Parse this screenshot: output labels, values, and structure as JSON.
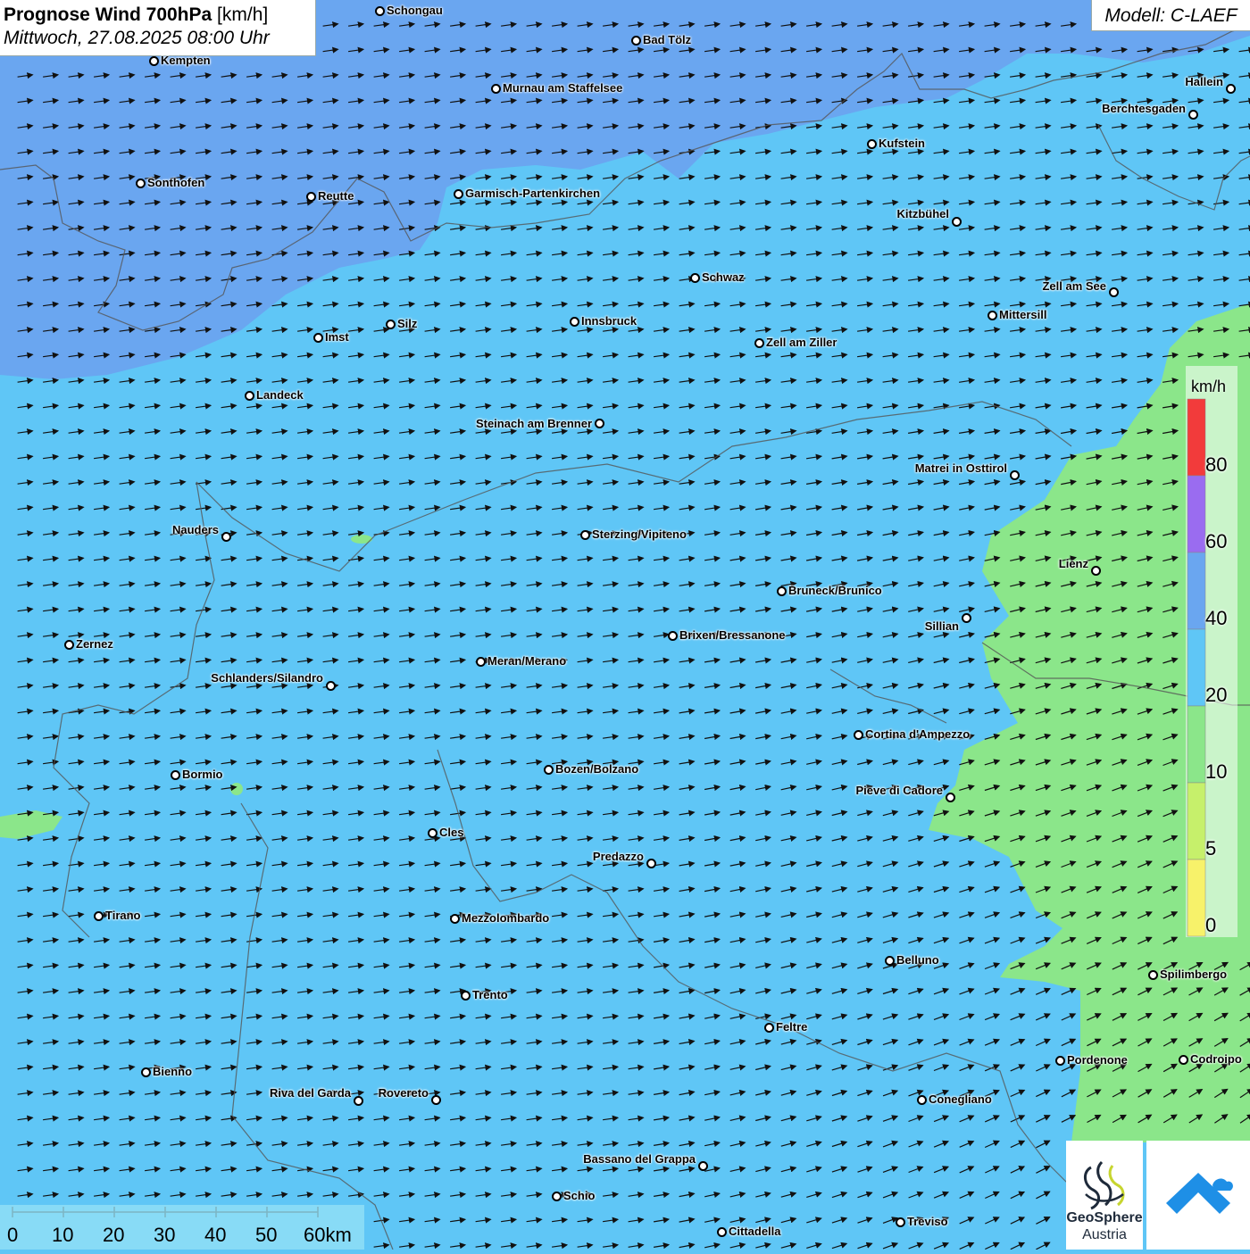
{
  "title": {
    "main": "Prognose Wind 700hPa",
    "unit": "[km/h]",
    "datetime": "Mittwoch, 27.08.2025 08:00 Uhr"
  },
  "model_label": "Modell: C-LAEF",
  "colors": {
    "band_0_5": "#f7f26a",
    "band_5_10": "#c6f06b",
    "band_10_20": "#8be68a",
    "band_20_40": "#5fc6f6",
    "band_40_60": "#6aa6f0",
    "band_60_80": "#9a6cf0",
    "band_80_plus": "#f23b3b"
  },
  "legend": {
    "unit": "km/h",
    "labels": [
      "80",
      "60",
      "40",
      "20",
      "10",
      "5",
      "0"
    ]
  },
  "cities": [
    {
      "name": "Schongau"
    },
    {
      "name": "Bad Tölz"
    },
    {
      "name": "Kempten"
    },
    {
      "name": "Murnau am Staffelsee"
    },
    {
      "name": "Hallein"
    },
    {
      "name": "Berchtesgaden"
    },
    {
      "name": "Kufstein"
    },
    {
      "name": "Sonthofen"
    },
    {
      "name": "Reutte"
    },
    {
      "name": "Garmisch-Partenkirchen"
    },
    {
      "name": "Kitzbühel"
    },
    {
      "name": "Schwaz"
    },
    {
      "name": "Zell am See"
    },
    {
      "name": "Mittersill"
    },
    {
      "name": "Imst"
    },
    {
      "name": "Silz"
    },
    {
      "name": "Innsbruck"
    },
    {
      "name": "Zell am Ziller"
    },
    {
      "name": "Landeck"
    },
    {
      "name": "Steinach am Brenner"
    },
    {
      "name": "Matrei in Osttirol"
    },
    {
      "name": "Nauders"
    },
    {
      "name": "Sterzing/Vipiteno"
    },
    {
      "name": "Lienz"
    },
    {
      "name": "Bruneck/Brunico"
    },
    {
      "name": "Sillian"
    },
    {
      "name": "Zernez"
    },
    {
      "name": "Brixen/Bressanone"
    },
    {
      "name": "Meran/Merano"
    },
    {
      "name": "Schlanders/Silandro"
    },
    {
      "name": "Cortina d'Ampezzo"
    },
    {
      "name": "Bormio"
    },
    {
      "name": "Bozen/Bolzano"
    },
    {
      "name": "Pieve di Cadore"
    },
    {
      "name": "Cles"
    },
    {
      "name": "Predazzo"
    },
    {
      "name": "Tirano"
    },
    {
      "name": "Mezzolombardo"
    },
    {
      "name": "Belluno"
    },
    {
      "name": "Spilimbergo"
    },
    {
      "name": "Trento"
    },
    {
      "name": "Feltre"
    },
    {
      "name": "Pordenone"
    },
    {
      "name": "Codroipo"
    },
    {
      "name": "Bienno"
    },
    {
      "name": "Riva del Garda"
    },
    {
      "name": "Rovereto"
    },
    {
      "name": "Conegliano"
    },
    {
      "name": "Bassano del Grappa"
    },
    {
      "name": "Schio"
    },
    {
      "name": "Treviso"
    },
    {
      "name": "Cittadella"
    }
  ],
  "scalebar": {
    "labels": [
      "0",
      "10",
      "20",
      "30",
      "40",
      "50",
      "60km"
    ]
  },
  "logos": {
    "geosphere_line1": "GeoSphere",
    "geosphere_line2": "Austria"
  },
  "wind": {
    "direction": "west to east, slightly south-west in the south-east",
    "icon": "wind-arrow-icon"
  }
}
